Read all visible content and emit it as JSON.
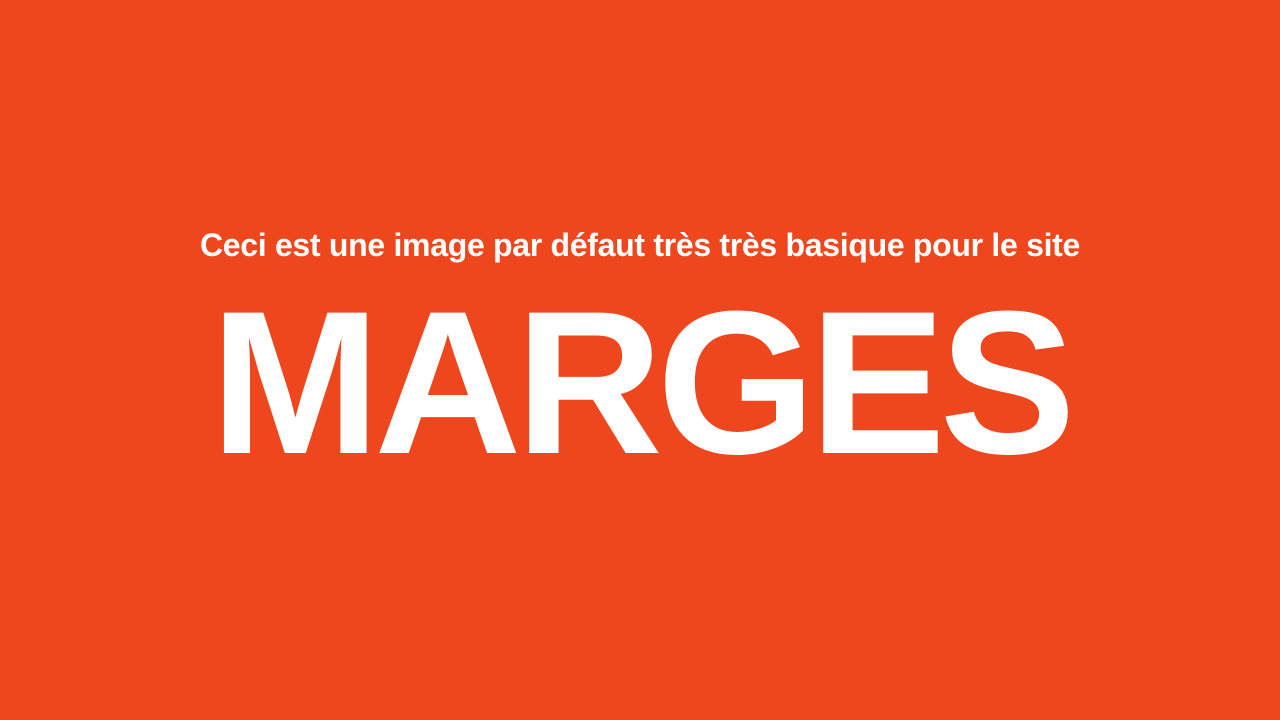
{
  "banner": {
    "subtitle": "Ceci est une image par défaut très très basique pour le site",
    "title": "MARGES"
  },
  "colors": {
    "background": "#EE471E",
    "text": "#FFFFFF"
  }
}
